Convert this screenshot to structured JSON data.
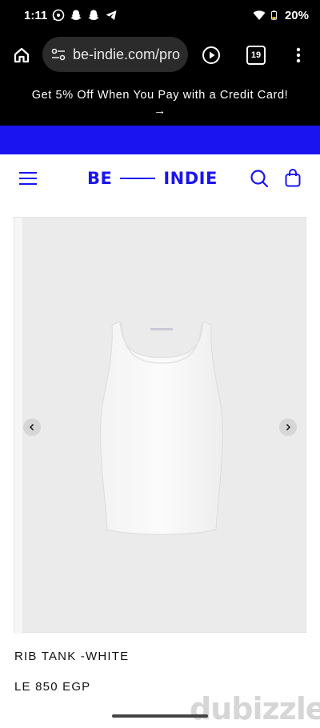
{
  "status_bar": {
    "time": "1:11",
    "battery": "20%",
    "notification_icons": [
      "whatsapp-icon",
      "snapchat-icon",
      "snapchat-icon",
      "telegram-icon"
    ]
  },
  "browser": {
    "url": "be-indie.com/pro",
    "tab_count": "19"
  },
  "promo_banner": {
    "text": "Get 5% Off When You Pay with a Credit Card!",
    "arrow": "→"
  },
  "header": {
    "logo_left": "BE",
    "logo_right": "INDIE"
  },
  "product": {
    "title": "RIB TANK -WHITE",
    "price": "LE 850 EGP"
  },
  "watermark": {
    "text": "dubizzle"
  },
  "colors": {
    "brand_blue": "#1a14f0",
    "promo_bg": "#000000",
    "image_bg": "#ebebeb"
  }
}
